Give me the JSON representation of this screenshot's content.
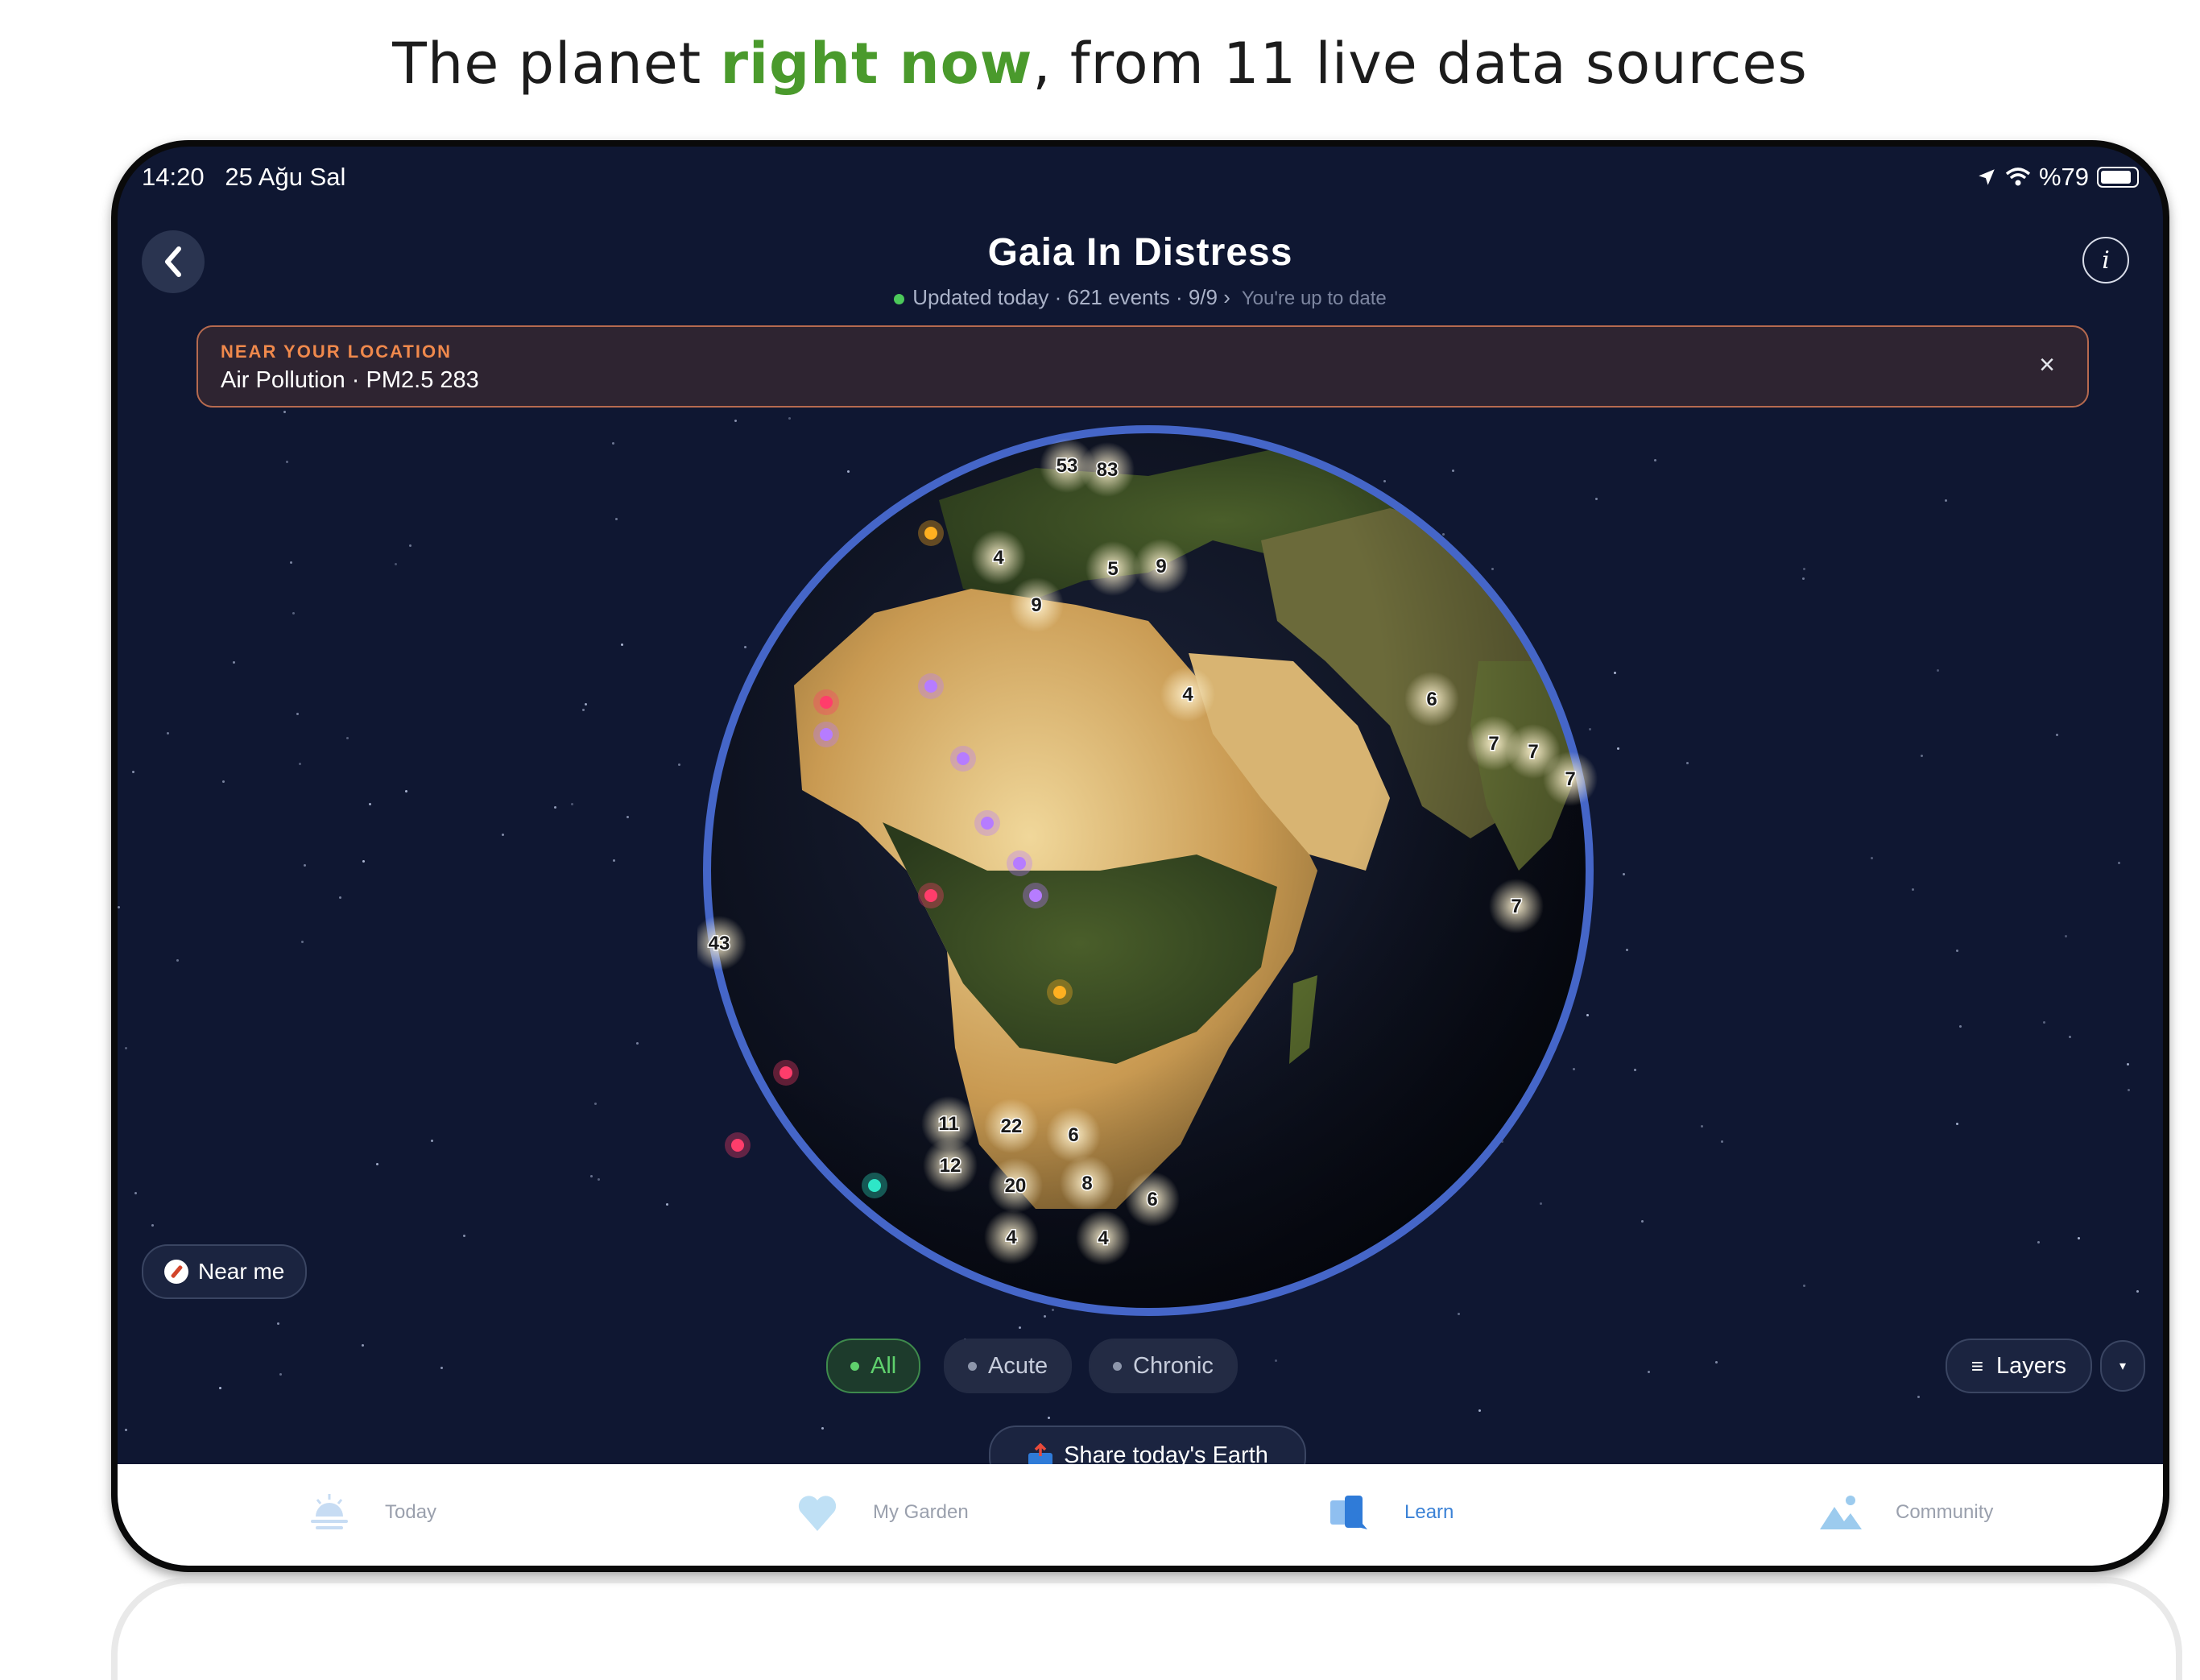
{
  "headline": {
    "pre": "The planet ",
    "highlight": "right now",
    "post": ", from 11 live data sources"
  },
  "status": {
    "time": "14:20",
    "date": "25 Ağu Sal",
    "battery": "%79"
  },
  "header": {
    "title": "Gaia In Distress",
    "updated": "Updated today · 621 events · 9/9 ›",
    "uptodate": "You're up to date"
  },
  "alert": {
    "kicker": "NEAR YOUR LOCATION",
    "message": "Air Pollution · PM2.5 283",
    "close": "×"
  },
  "globe": {
    "cluster_labels": [
      "53",
      "83",
      "4",
      "5",
      "9",
      "9",
      "4",
      "6",
      "7",
      "7",
      "7",
      "7",
      "43",
      "11",
      "22",
      "6",
      "12",
      "20",
      "8",
      "6",
      "4",
      "4"
    ]
  },
  "controls": {
    "near_me": "Near me",
    "filters": {
      "all": "All",
      "acute": "Acute",
      "chronic": "Chronic"
    },
    "layers": "Layers",
    "share": "Share today's Earth"
  },
  "tabs": [
    {
      "label": "Today",
      "icon": "sunrise-icon"
    },
    {
      "label": "My Garden",
      "icon": "heart-icon"
    },
    {
      "label": "Learn",
      "icon": "book-icon",
      "active": true
    },
    {
      "label": "Community",
      "icon": "landscape-icon"
    }
  ],
  "colors": {
    "accent_green": "#4a9a2c",
    "active_tab": "#3b82d6",
    "alert_orange": "#f0894c",
    "space": "#0f1732"
  }
}
